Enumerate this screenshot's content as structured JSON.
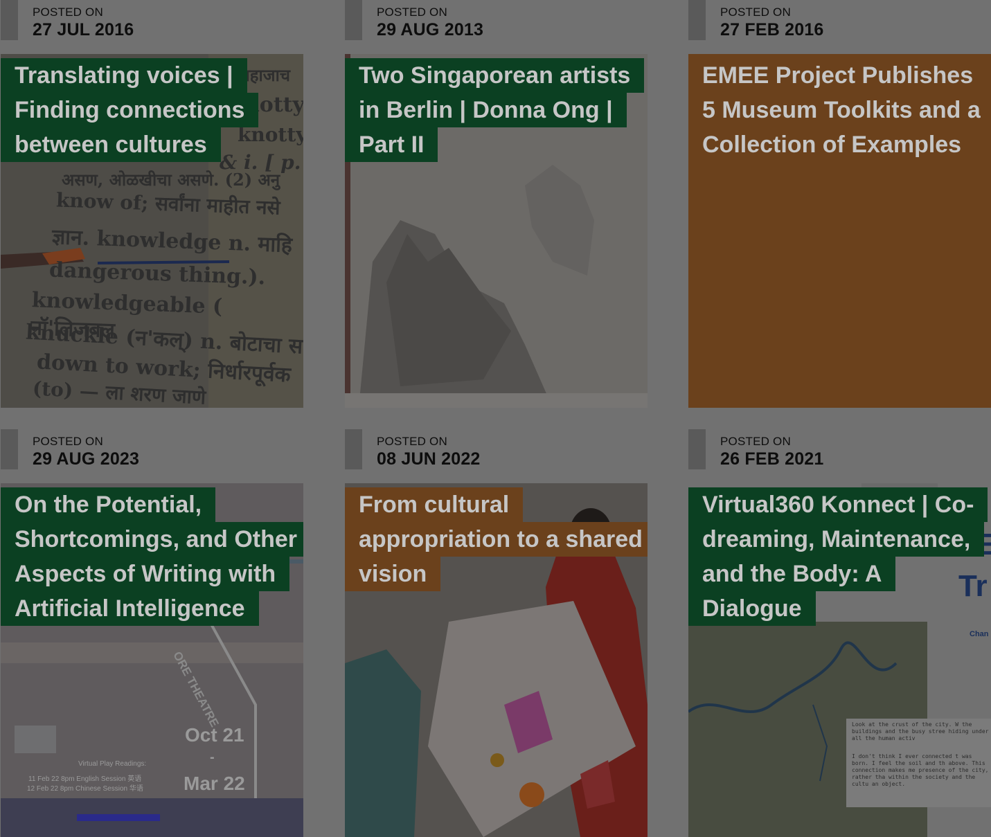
{
  "posted_label": "POSTED ON",
  "posts": [
    {
      "date": "27 JUL 2016",
      "title": "Translating voices | Finding connections between cultures",
      "title_style": "green",
      "image": "dictionary-page",
      "image_text": {
        "l1": "know of; सर्वांना माहीत नसे",
        "l2": "ज्ञान. knowledge n. माहि",
        "l3": "dangerous thing.).",
        "l4": "knowledgeable ( नॉ'लिजबल",
        "l5": "knuckle (न'कल्) n. बोटाचा स",
        "l6": "down to work; निर्धारपूर्वक",
        "l7": "(to) — ला शरण जाणे",
        "r1": "जहाजाच",
        "r2": "notty",
        "r3": "knotty",
        "r4": "& i. [ p.",
        "r5": "असण, ओळखीचा असणे. (2) अनु"
      }
    },
    {
      "date": "29 AUG 2013",
      "title": "Two Singaporean artists in Berlin | Donna Ong | Part II",
      "title_style": "green",
      "image": "ink-landscape-painting"
    },
    {
      "date": "27 FEB 2016",
      "title": "EMEE Project Publishes 5 Museum Toolkits and a Collection of Examples",
      "title_style": "plain",
      "image": "solid-brown-panel"
    },
    {
      "date": "29 AUG 2023",
      "title": "On the Potential, Shortcomings, and Other Aspects of Writing with Artificial Intelligence",
      "title_style": "green",
      "image": "glitch-theatre-poster",
      "image_text": {
        "theatre": "ORE THEATRE",
        "from": "Oct 21",
        "dash": "-",
        "to": "Mar 22",
        "readings": "Virtual Play Readings:",
        "session1": "11 Feb 22 8pm English Session 英语",
        "session2": "12 Feb 22 8pm Chinese Session 华语"
      }
    },
    {
      "date": "08 JUN 2022",
      "title": "From cultural appropriation to a shared vision",
      "title_style": "brown",
      "image": "women-painting-fabric"
    },
    {
      "date": "26 FEB 2021",
      "title": "Virtual360 Konnect | Co-dreaming, Maintenance, and the Body: A Dialogue",
      "title_style": "green",
      "image": "satellite-map-with-text",
      "image_text": {
        "big1": "E",
        "big2": "Tr",
        "small": "Chan",
        "p1": "Look at the crust of the city. W the buildings and the busy stree hiding under all the human activ",
        "p2": "I don't think I ever connected t was born. I feel the soil and th above. This connection makes me presence of the city, rather tha within the society and the cultu an object."
      }
    }
  ]
}
